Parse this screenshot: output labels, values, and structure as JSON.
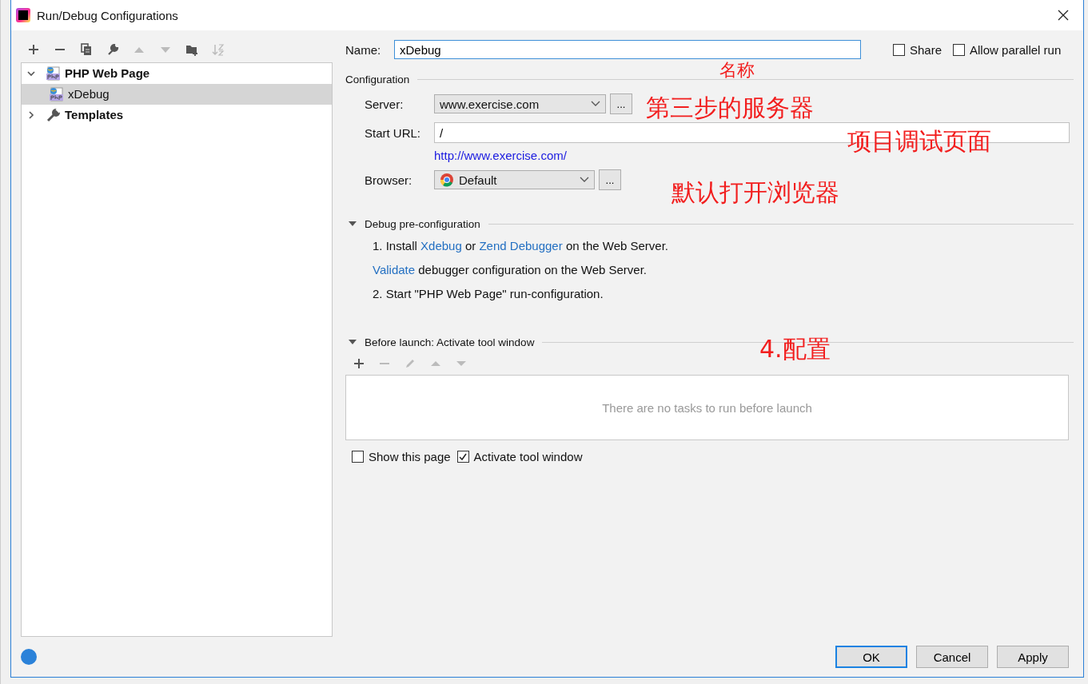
{
  "window": {
    "title": "Run/Debug Configurations"
  },
  "tree": [
    {
      "label": "PHP Web Page",
      "kind": "php",
      "expanded": true,
      "selected": false,
      "children": [
        {
          "label": "xDebug",
          "kind": "php",
          "selected": true
        }
      ]
    },
    {
      "label": "Templates",
      "kind": "wrench",
      "expanded": false,
      "selected": false
    }
  ],
  "name": {
    "label": "Name:",
    "value": "xDebug"
  },
  "share": {
    "label": "Share",
    "checked": false
  },
  "parallel": {
    "label": "Allow parallel run",
    "checked": false
  },
  "configuration": {
    "title": "Configuration",
    "server": {
      "label": "Server:",
      "value": "www.exercise.com",
      "button": "..."
    },
    "start_url": {
      "label": "Start URL:",
      "value": "/"
    },
    "url_link": "http://www.exercise.com/",
    "browser": {
      "label": "Browser:",
      "value": "Default",
      "button": "..."
    }
  },
  "debug_preconfiguration": {
    "title": "Debug pre-configuration",
    "expanded": true,
    "lines": [
      [
        {
          "kind": "text",
          "text": "1. Install"
        },
        {
          "kind": "link",
          "text": "Xdebug"
        },
        {
          "kind": "text",
          "text": "or"
        },
        {
          "kind": "link",
          "text": "Zend Debugger"
        },
        {
          "kind": "text",
          "text": "on the Web Server."
        }
      ],
      [
        {
          "kind": "link",
          "text": "Validate"
        },
        {
          "kind": "text",
          "text": "debugger configuration on the Web Server."
        }
      ],
      [
        {
          "kind": "text",
          "text": "2. Start \"PHP Web Page\" run-configuration."
        }
      ]
    ]
  },
  "before_launch": {
    "title": "Before launch: Activate tool window",
    "expanded": true,
    "empty_text": "There are no tasks to run before launch"
  },
  "options": [
    {
      "label": "Show this page",
      "checked": false
    },
    {
      "label": "Activate tool window",
      "checked": true
    }
  ],
  "buttons": [
    {
      "label": "OK",
      "default": true
    },
    {
      "label": "Cancel",
      "default": false
    },
    {
      "label": "Apply",
      "default": false
    }
  ],
  "annotations": [
    {
      "text": "名称"
    },
    {
      "text": "第三步的服务器"
    },
    {
      "text": "项目调试页面"
    },
    {
      "text": "默认打开浏览器"
    },
    {
      "text": "4.配置"
    }
  ]
}
